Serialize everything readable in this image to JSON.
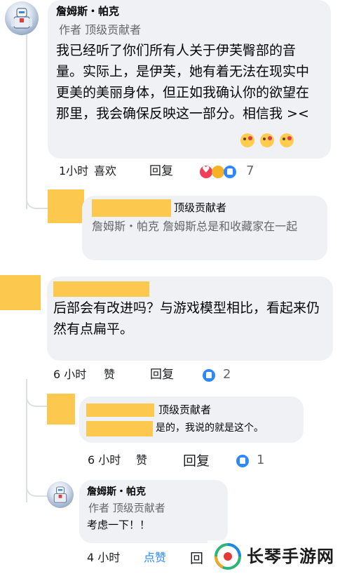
{
  "comments": [
    {
      "author": "詹姆斯・帕克",
      "badges": "作者 顶级贡献者",
      "text": "我已经听了你们所有人关于伊芙臀部的音量。实际上，是伊芙，她有着无法在现实中更美的美丽身体，但正如我确认你的欲望在那里，我会确保反映这一部分。相信我 ><",
      "time": "1小时",
      "like_label": "喜欢",
      "reply_label": "回复",
      "reaction_count": "7"
    },
    {
      "badge": "顶级贡献者",
      "text": "詹姆斯・帕克 詹姆斯总是和收藏家在一起"
    },
    {
      "text": "后部会有改进吗？与游戏模型相比，看起来仍然有点扁平。",
      "time": "6 小时",
      "like_label": "赞",
      "reply_label": "回复",
      "reaction_count": "2"
    },
    {
      "badge": "顶级贡献者",
      "text": "是的，我说的就是这个。",
      "time": "6 小时",
      "like_label": "赞",
      "reply_label": "回复",
      "reaction_count": "1"
    },
    {
      "author": "詹姆斯・帕克",
      "badges": "作者 顶级贡献者",
      "text": "考虑一下！！",
      "time": "4 小时",
      "like_label": "点赞",
      "reply_label": "回"
    }
  ],
  "watermark": "长琴手游网",
  "colors": {
    "bubble": "#eff1f4",
    "redaction": "#fdc84e",
    "like_blue": "#2d88ff",
    "meta_gray": "#65676b"
  }
}
